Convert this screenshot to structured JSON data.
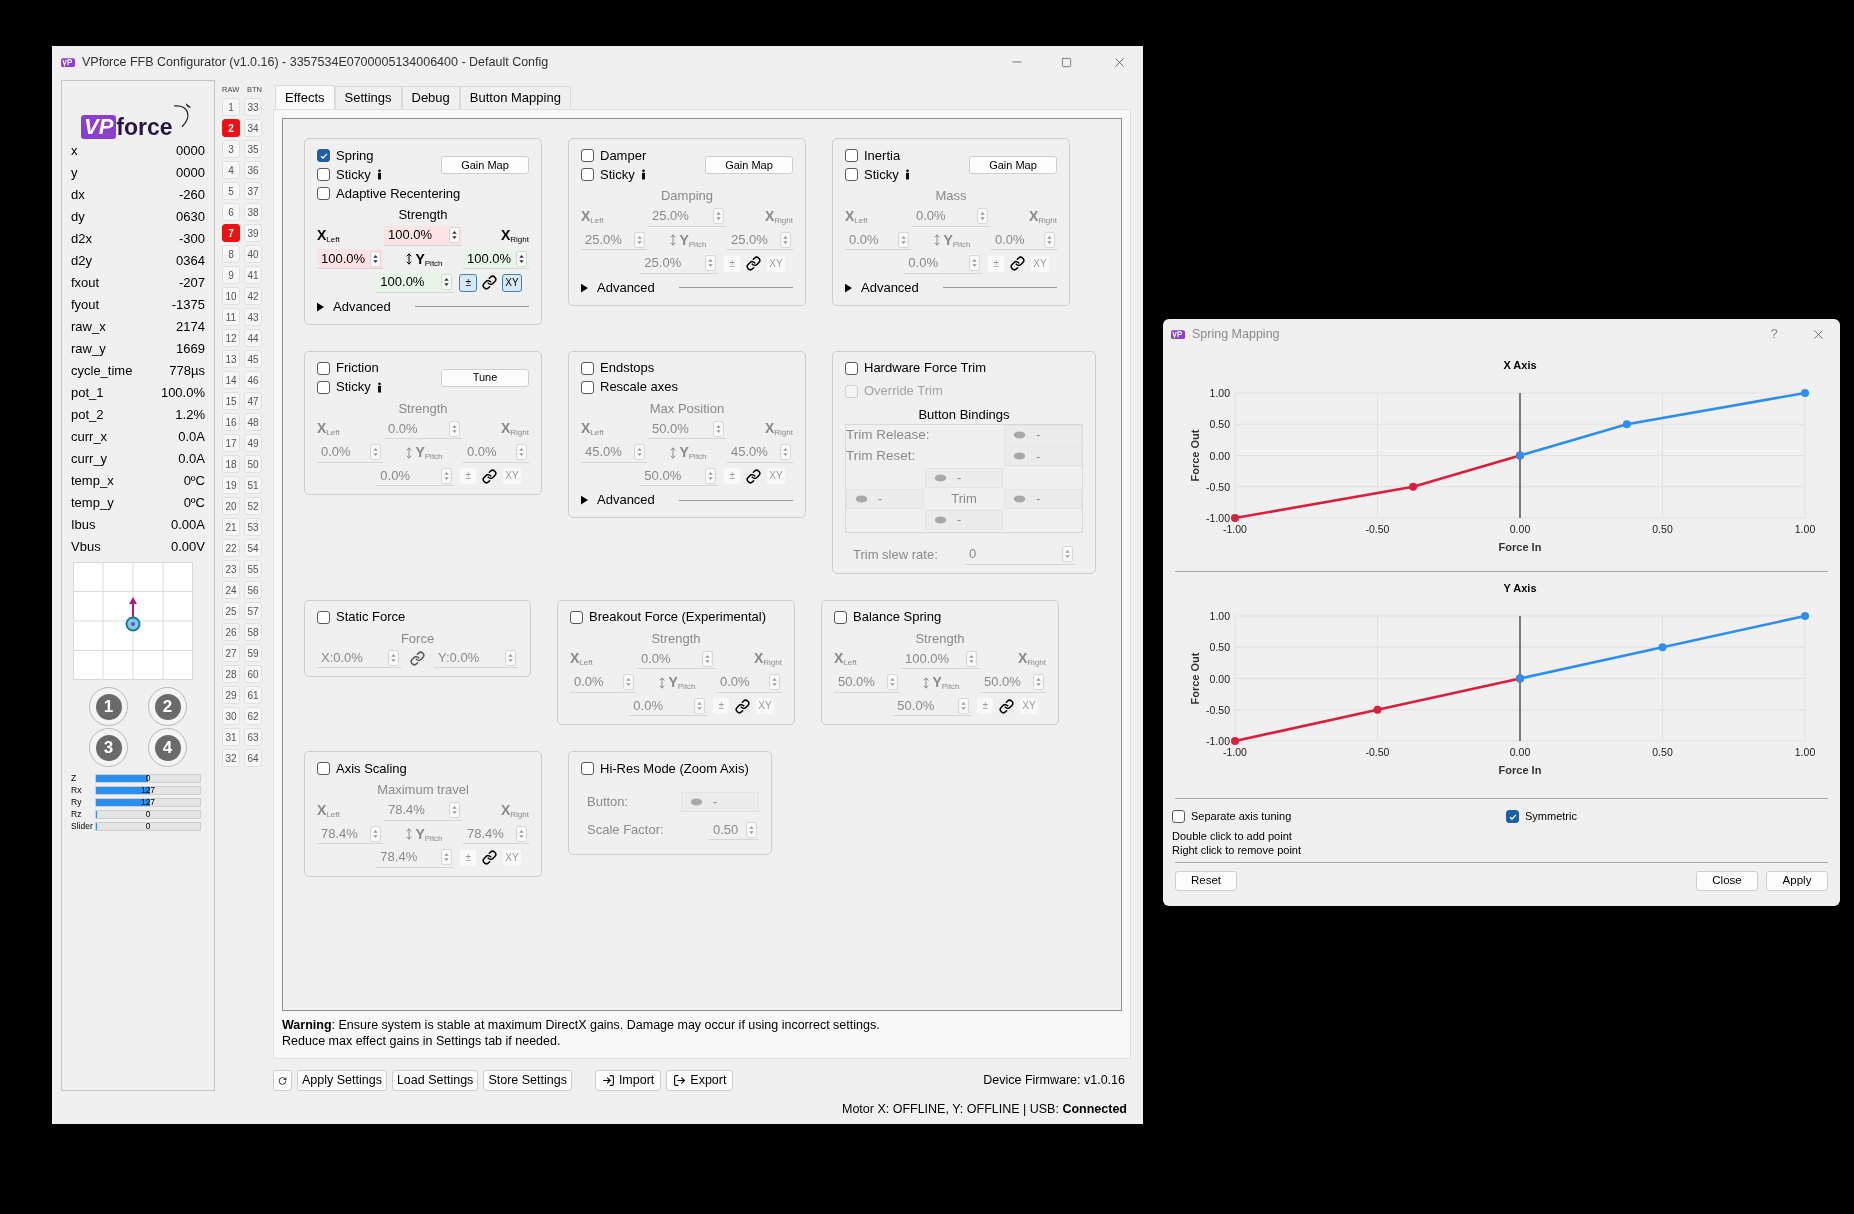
{
  "main_window": {
    "title": "VPforce FFB Configurator (v1.0.16) - 3357534E0700005134006400 - Default Config"
  },
  "sidebar": {
    "logo": {
      "prefix": "VP",
      "suffix": "force"
    },
    "readings": [
      {
        "label": "x",
        "value": "0000"
      },
      {
        "label": "y",
        "value": "0000"
      },
      {
        "label": "dx",
        "value": "-260"
      },
      {
        "label": "dy",
        "value": "0630"
      },
      {
        "label": "d2x",
        "value": "-300"
      },
      {
        "label": "d2y",
        "value": "0364"
      },
      {
        "label": "fxout",
        "value": "-207"
      },
      {
        "label": "fyout",
        "value": "-1375"
      },
      {
        "label": "raw_x",
        "value": "2174"
      },
      {
        "label": "raw_y",
        "value": "1669"
      },
      {
        "label": "cycle_time",
        "value": "778µs"
      },
      {
        "label": "pot_1",
        "value": "100.0%"
      },
      {
        "label": "pot_2",
        "value": "1.2%"
      },
      {
        "label": "curr_x",
        "value": "0.0A"
      },
      {
        "label": "curr_y",
        "value": "0.0A"
      },
      {
        "label": "temp_x",
        "value": "0ºC"
      },
      {
        "label": "temp_y",
        "value": "0ºC"
      },
      {
        "label": "Ibus",
        "value": "0.00A"
      },
      {
        "label": "Vbus",
        "value": "0.00V"
      }
    ],
    "hat_buttons": [
      "1",
      "2",
      "3",
      "4"
    ],
    "axes": [
      {
        "label": "Z",
        "value": "0",
        "level": 0.5
      },
      {
        "label": "Rx",
        "value": "127",
        "level": 0.52
      },
      {
        "label": "Ry",
        "value": "127",
        "level": 0.52
      },
      {
        "label": "Rz",
        "value": "0",
        "level": 0
      },
      {
        "label": "Slider",
        "value": "0",
        "level": 0
      }
    ]
  },
  "button_states": {
    "headers": [
      "RAW",
      "BTN"
    ],
    "columns": [
      [
        {
          "label": "1",
          "pressed": false
        },
        {
          "label": "2",
          "pressed": true
        },
        {
          "label": "3",
          "pressed": false
        },
        {
          "label": "4",
          "pressed": false
        },
        {
          "label": "5",
          "pressed": false
        },
        {
          "label": "6",
          "pressed": false
        },
        {
          "label": "7",
          "pressed": true
        },
        {
          "label": "8",
          "pressed": false
        },
        {
          "label": "9",
          "pressed": false
        },
        {
          "label": "10",
          "pressed": false
        },
        {
          "label": "11",
          "pressed": false
        },
        {
          "label": "12",
          "pressed": false
        },
        {
          "label": "13",
          "pressed": false
        },
        {
          "label": "14",
          "pressed": false
        },
        {
          "label": "15",
          "pressed": false
        },
        {
          "label": "16",
          "pressed": false
        },
        {
          "label": "17",
          "pressed": false
        },
        {
          "label": "18",
          "pressed": false
        },
        {
          "label": "19",
          "pressed": false
        },
        {
          "label": "20",
          "pressed": false
        },
        {
          "label": "21",
          "pressed": false
        },
        {
          "label": "22",
          "pressed": false
        },
        {
          "label": "23",
          "pressed": false
        },
        {
          "label": "24",
          "pressed": false
        },
        {
          "label": "25",
          "pressed": false
        },
        {
          "label": "26",
          "pressed": false
        },
        {
          "label": "27",
          "pressed": false
        },
        {
          "label": "28",
          "pressed": false
        },
        {
          "label": "29",
          "pressed": false
        },
        {
          "label": "30",
          "pressed": false
        },
        {
          "label": "31",
          "pressed": false
        },
        {
          "label": "32",
          "pressed": false
        }
      ],
      [
        {
          "label": "33",
          "pressed": false
        },
        {
          "label": "34",
          "pressed": false
        },
        {
          "label": "35",
          "pressed": false
        },
        {
          "label": "36",
          "pressed": false
        },
        {
          "label": "37",
          "pressed": false
        },
        {
          "label": "38",
          "pressed": false
        },
        {
          "label": "39",
          "pressed": false
        },
        {
          "label": "40",
          "pressed": false
        },
        {
          "label": "41",
          "pressed": false
        },
        {
          "label": "42",
          "pressed": false
        },
        {
          "label": "43",
          "pressed": false
        },
        {
          "label": "44",
          "pressed": false
        },
        {
          "label": "45",
          "pressed": false
        },
        {
          "label": "46",
          "pressed": false
        },
        {
          "label": "47",
          "pressed": false
        },
        {
          "label": "48",
          "pressed": false
        },
        {
          "label": "49",
          "pressed": false
        },
        {
          "label": "50",
          "pressed": false
        },
        {
          "label": "51",
          "pressed": false
        },
        {
          "label": "52",
          "pressed": false
        },
        {
          "label": "53",
          "pressed": false
        },
        {
          "label": "54",
          "pressed": false
        },
        {
          "label": "55",
          "pressed": false
        },
        {
          "label": "56",
          "pressed": false
        },
        {
          "label": "57",
          "pressed": false
        },
        {
          "label": "58",
          "pressed": false
        },
        {
          "label": "59",
          "pressed": false
        },
        {
          "label": "60",
          "pressed": false
        },
        {
          "label": "61",
          "pressed": false
        },
        {
          "label": "62",
          "pressed": false
        },
        {
          "label": "63",
          "pressed": false
        },
        {
          "label": "64",
          "pressed": false
        }
      ]
    ]
  },
  "tabs": [
    {
      "label": "Effects",
      "selected": true
    },
    {
      "label": "Settings",
      "selected": false
    },
    {
      "label": "Debug",
      "selected": false
    },
    {
      "label": "Button Mapping",
      "selected": false
    }
  ],
  "effect_rows": [
    [
      {
        "kind": "effect",
        "checkboxes": [
          {
            "label": "Spring",
            "checked": true
          },
          {
            "label": "Sticky",
            "checked": false,
            "hint_icon": true
          },
          {
            "label": "Adaptive Recentering",
            "checked": false
          }
        ],
        "button": "Gain Map",
        "group": {
          "title": "Strength",
          "enabled": true,
          "x_left": "X$_{Left}$",
          "x_right": "X$_{Right}$",
          "y_axis": "Y$_{Pitch}$",
          "top": {
            "value": "100.0%",
            "color": "#fde3e3"
          },
          "left": {
            "value": "100.0%",
            "color": "#fde3e3"
          },
          "right": {
            "value": "100.0%",
            "color": "#e6f5e6"
          },
          "bottom": {
            "value": "100.0%",
            "color": "#e6f5e6"
          },
          "symmetric": {
            "label": "±",
            "on": true
          },
          "xy": {
            "label": "XY",
            "on": true
          }
        },
        "advanced": {
          "label": "Advanced",
          "expanded": false
        }
      },
      {
        "kind": "effect",
        "checkboxes": [
          {
            "label": "Damper",
            "checked": false
          },
          {
            "label": "Sticky",
            "checked": false,
            "hint_icon": true
          }
        ],
        "button": "Gain Map",
        "group": {
          "title": "Damping",
          "enabled": false,
          "x_left": "X$_{Left}$",
          "x_right": "X$_{Right}$",
          "y_axis": "Y$_{Pitch}$",
          "top": {
            "value": "25.0%"
          },
          "left": {
            "value": "25.0%"
          },
          "right": {
            "value": "25.0%"
          },
          "bottom": {
            "value": "25.0%"
          },
          "symmetric": {
            "label": "±",
            "on": false
          },
          "xy": {
            "label": "XY",
            "on": false
          }
        },
        "advanced": {
          "label": "Advanced",
          "expanded": false
        }
      },
      {
        "kind": "effect",
        "checkboxes": [
          {
            "label": "Inertia",
            "checked": false
          },
          {
            "label": "Sticky",
            "checked": false,
            "hint_icon": true
          }
        ],
        "button": "Gain Map",
        "group": {
          "title": "Mass",
          "enabled": false,
          "x_left": "X$_{Left}$",
          "x_right": "X$_{Right}$",
          "y_axis": "Y$_{Pitch}$",
          "top": {
            "value": "0.0%"
          },
          "left": {
            "value": "0.0%"
          },
          "right": {
            "value": "0.0%"
          },
          "bottom": {
            "value": "0.0%"
          },
          "symmetric": {
            "label": "±",
            "on": false
          },
          "xy": {
            "label": "XY",
            "on": false
          }
        },
        "advanced": {
          "label": "Advanced",
          "expanded": false
        }
      }
    ],
    [
      {
        "kind": "effect",
        "checkboxes": [
          {
            "label": "Friction",
            "checked": false
          },
          {
            "label": "Sticky",
            "checked": false,
            "hint_icon": true
          }
        ],
        "button": "Tune",
        "group": {
          "title": "Strength",
          "enabled": false,
          "x_left": "X$_{Left}$",
          "x_right": "X$_{Right}$",
          "y_axis": "Y$_{Pitch}$",
          "top": {
            "value": "0.0%"
          },
          "left": {
            "value": "0.0%"
          },
          "right": {
            "value": "0.0%"
          },
          "bottom": {
            "value": "0.0%"
          },
          "symmetric": {
            "label": "±",
            "on": false
          },
          "xy": {
            "label": "XY",
            "on": false
          }
        }
      },
      {
        "kind": "effect",
        "checkboxes": [
          {
            "label": "Endstops",
            "checked": false
          },
          {
            "label": "Rescale axes",
            "checked": false
          }
        ],
        "group": {
          "title": "Max Position",
          "enabled": false,
          "x_left": "X$_{Left}$",
          "x_right": "X$_{Right}$",
          "y_axis": "Y$_{Pitch}$",
          "top": {
            "value": "50.0%"
          },
          "left": {
            "value": "45.0%"
          },
          "right": {
            "value": "45.0%"
          },
          "bottom": {
            "value": "50.0%"
          },
          "symmetric": {
            "label": "±",
            "on": false
          },
          "xy": {
            "label": "XY",
            "on": false
          }
        },
        "advanced": {
          "label": "Advanced",
          "expanded": false
        }
      },
      {
        "kind": "trim",
        "checkboxes": [
          {
            "label": "Hardware Force Trim",
            "checked": false,
            "disabled": false
          },
          {
            "label": "Override Trim",
            "checked": false,
            "disabled": true
          }
        ],
        "bindings": {
          "title": "Button Bindings",
          "rows": [
            {
              "label": "Trim Release:",
              "value": "-"
            },
            {
              "label": "Trim Reset:",
              "value": "-"
            }
          ],
          "hat": {
            "up": "-",
            "left": "-",
            "center": "Trim",
            "right": "-",
            "down": "-"
          }
        },
        "slew": {
          "label": "Trim slew rate:",
          "value": "0"
        }
      }
    ],
    [
      {
        "kind": "static",
        "checkboxes": [
          {
            "label": "Static Force",
            "checked": false
          }
        ],
        "title": "Force",
        "x": "X:0.0%",
        "y": "Y:0.0%"
      },
      {
        "kind": "effect",
        "checkboxes": [
          {
            "label": "Breakout Force (Experimental)",
            "checked": false
          }
        ],
        "group": {
          "title": "Strength",
          "enabled": false,
          "x_left": "X$_{Left}$",
          "x_right": "X$_{Right}$",
          "y_axis": "Y$_{Pitch}$",
          "top": {
            "value": "0.0%"
          },
          "left": {
            "value": "0.0%"
          },
          "right": {
            "value": "0.0%"
          },
          "bottom": {
            "value": "0.0%"
          },
          "symmetric": {
            "label": "±",
            "on": false
          },
          "xy": {
            "label": "XY",
            "on": false
          }
        }
      },
      {
        "kind": "effect",
        "checkboxes": [
          {
            "label": "Balance Spring",
            "checked": false
          }
        ],
        "group": {
          "title": "Strength",
          "enabled": false,
          "x_left": "X$_{Left}$",
          "x_right": "X$_{Right}$",
          "y_axis": "Y$_{Pitch}$",
          "top": {
            "value": "100.0%"
          },
          "left": {
            "value": "50.0%"
          },
          "right": {
            "value": "50.0%"
          },
          "bottom": {
            "value": "50.0%"
          },
          "symmetric": {
            "label": "±",
            "on": false
          },
          "xy": {
            "label": "XY",
            "on": false
          }
        }
      }
    ],
    [
      {
        "kind": "effect",
        "checkboxes": [
          {
            "label": "Axis Scaling",
            "checked": false
          }
        ],
        "group": {
          "title": "Maximum travel",
          "enabled": false,
          "x_left": "X$_{Left}$",
          "x_right": "X$_{Right}$",
          "y_axis": "Y$_{Pitch}$",
          "top": {
            "value": "78.4%"
          },
          "left": {
            "value": "78.4%"
          },
          "right": {
            "value": "78.4%"
          },
          "bottom": {
            "value": "78.4%"
          },
          "symmetric": {
            "label": "±",
            "on": false
          },
          "xy": {
            "label": "XY",
            "on": false
          }
        }
      },
      {
        "kind": "hires",
        "checkboxes": [
          {
            "label": "Hi-Res Mode (Zoom Axis)",
            "checked": false
          }
        ],
        "button_label": "Button:",
        "button_value": "-",
        "scale_label": "Scale Factor:",
        "scale_value": "0.50"
      }
    ]
  ],
  "warning": [
    "**Warning**: Ensure system is stable at maximum DirectX gains. Damage may occur if using incorrect settings.",
    "Reduce max effect gains in Settings tab if needed."
  ],
  "actions": [
    {
      "kind": "refresh"
    },
    {
      "kind": "text",
      "label": "Apply Settings"
    },
    {
      "kind": "text",
      "label": "Load Settings"
    },
    {
      "kind": "text",
      "label": "Store Settings"
    },
    {
      "kind": "import",
      "label": "Import"
    },
    {
      "kind": "export",
      "label": "Export"
    }
  ],
  "firmware": "Device Firmware: v1.0.16",
  "status": "Motor X: OFFLINE, Y: OFFLINE | USB: **Connected**",
  "dialog": {
    "title": "Spring Mapping",
    "help": "?",
    "charts": [
      {
        "chart_data": {
          "type": "line",
          "title": "X Axis",
          "xlabel": "Force In",
          "ylabel": "Force Out",
          "grid": true,
          "x": [
            -1,
            -0.375,
            0,
            0.375,
            1
          ],
          "series": [
            {
              "color": "#dc1e3c",
              "marker": "circle",
              "values": [
                -1,
                -0.5,
                0,
                null,
                null
              ]
            },
            {
              "color": "#2b8ff0",
              "marker": "circle",
              "values": [
                null,
                null,
                0,
                0.5,
                1
              ]
            }
          ],
          "xlim": [
            -1,
            1
          ],
          "ylim": [
            -1,
            1
          ],
          "xticks": [
            {
              "value": -1,
              "label": "-1.00"
            },
            {
              "value": -0.5,
              "label": "-0.50"
            },
            {
              "value": 0,
              "label": "0.00"
            },
            {
              "value": 0.5,
              "label": "0.50"
            },
            {
              "value": 1,
              "label": "1.00"
            }
          ],
          "yticks": [
            {
              "value": 1,
              "label": "1.00"
            },
            {
              "value": 0.5,
              "label": "0.50"
            },
            {
              "value": 0,
              "label": "0.00"
            },
            {
              "value": -0.5,
              "label": "-0.50"
            },
            {
              "value": -1,
              "label": "-1.00"
            }
          ]
        }
      },
      {
        "chart_data": {
          "type": "line",
          "title": "Y Axis",
          "xlabel": "Force In",
          "ylabel": "Force Out",
          "grid": true,
          "x": [
            -1,
            -0.5,
            0,
            0.5,
            1
          ],
          "series": [
            {
              "color": "#dc1e3c",
              "marker": "circle",
              "values": [
                -1,
                -0.5,
                0,
                null,
                null
              ]
            },
            {
              "color": "#2b8ff0",
              "marker": "circle",
              "values": [
                null,
                null,
                0,
                0.5,
                1
              ]
            }
          ],
          "xlim": [
            -1,
            1
          ],
          "ylim": [
            -1,
            1
          ],
          "xticks": [
            {
              "value": -1,
              "label": "-1.00"
            },
            {
              "value": -0.5,
              "label": "-0.50"
            },
            {
              "value": 0,
              "label": "0.00"
            },
            {
              "value": 0.5,
              "label": "0.50"
            },
            {
              "value": 1,
              "label": "1.00"
            }
          ],
          "yticks": [
            {
              "value": 1,
              "label": "1.00"
            },
            {
              "value": 0.5,
              "label": "0.50"
            },
            {
              "value": 0,
              "label": "0.00"
            },
            {
              "value": -0.5,
              "label": "-0.50"
            },
            {
              "value": -1,
              "label": "-1.00"
            }
          ]
        }
      }
    ],
    "options": [
      {
        "label": "Separate axis tuning",
        "checked": false
      },
      {
        "label": "Symmetric",
        "checked": true
      }
    ],
    "notes": [
      "Double click to add point",
      "Right click to remove point"
    ],
    "buttons": [
      "Reset",
      "Close",
      "Apply"
    ]
  }
}
